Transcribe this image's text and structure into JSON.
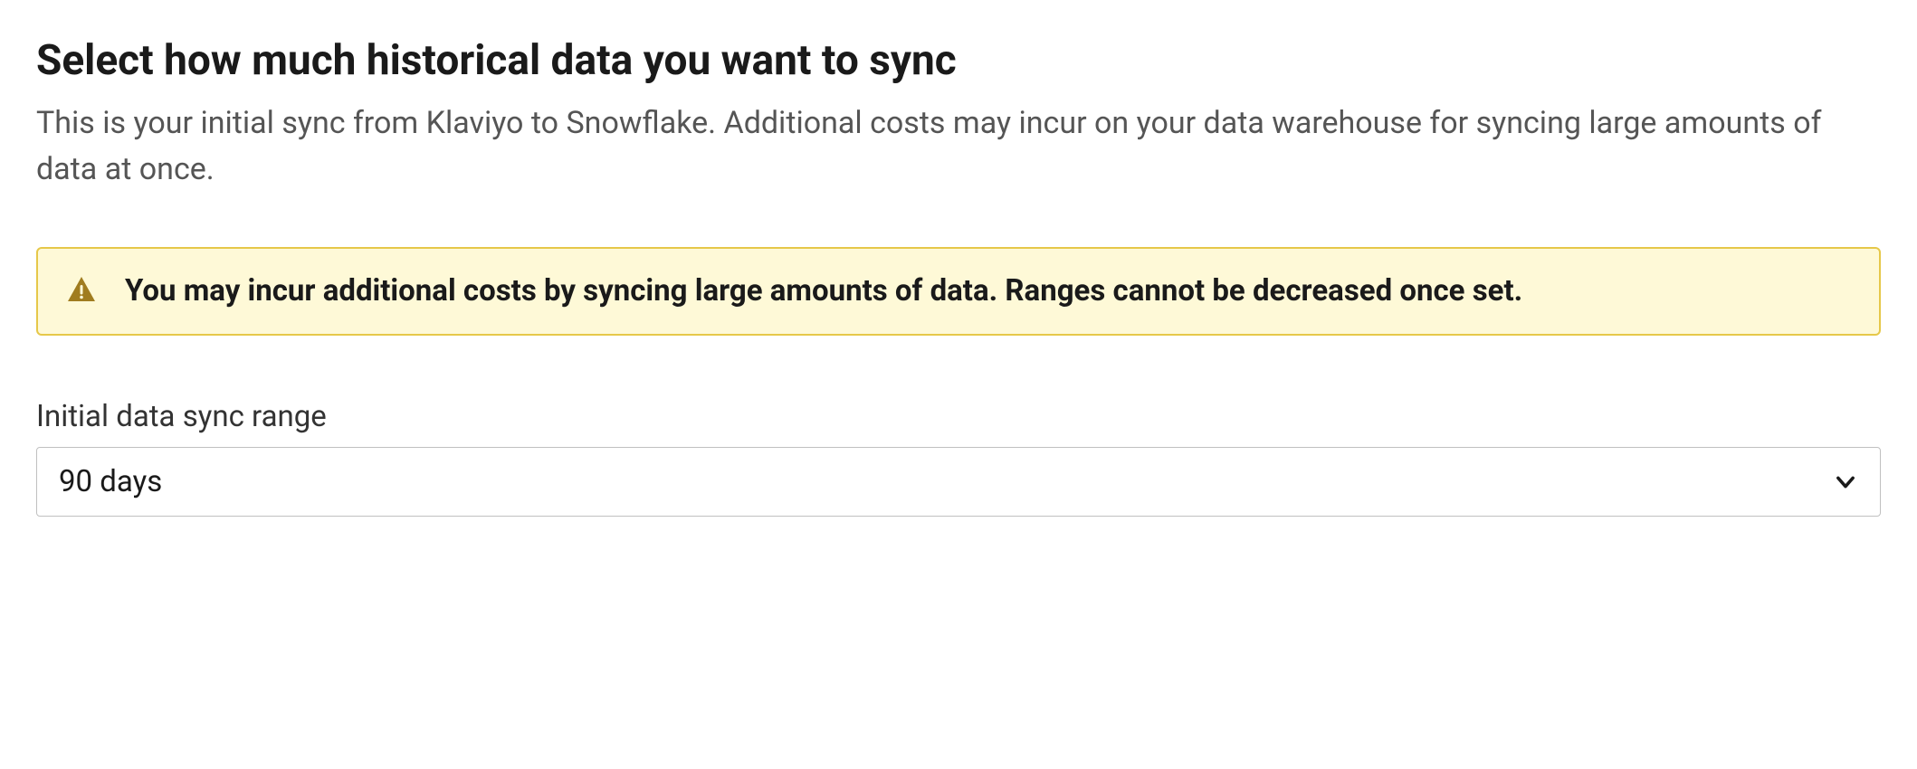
{
  "heading": "Select how much historical data you want to sync",
  "description": "This is your initial sync from Klaviyo to Snowflake. Additional costs may incur on your data warehouse for syncing large amounts of data at once.",
  "alert": {
    "message": "You may incur additional costs by syncing large amounts of data. Ranges cannot be decreased once set."
  },
  "field": {
    "label": "Initial data sync range",
    "selected_value": "90 days"
  }
}
